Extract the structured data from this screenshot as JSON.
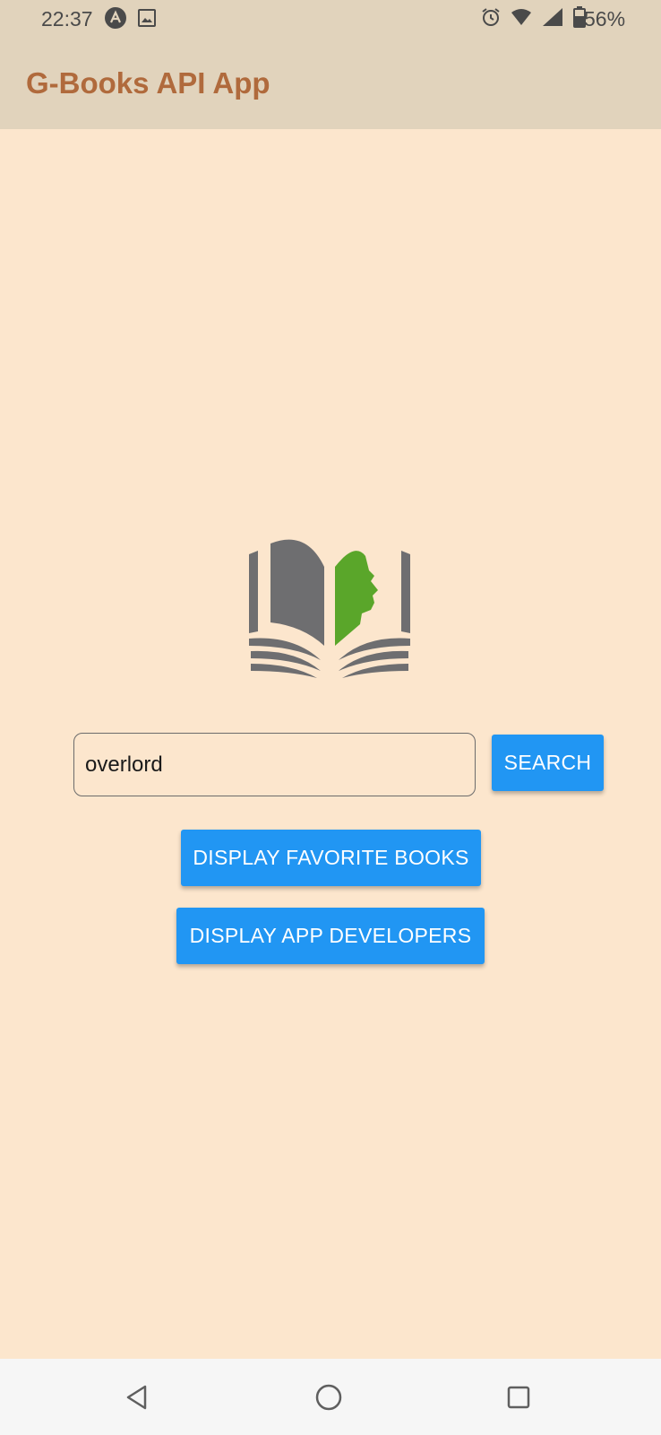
{
  "status_bar": {
    "time": "22:37",
    "battery_percent": "56%",
    "left_icons": [
      "android-notification-icon",
      "image-notification-icon"
    ],
    "right_icons": [
      "alarm-icon",
      "wifi-icon",
      "cell-signal-icon",
      "battery-icon"
    ]
  },
  "app_bar": {
    "title": "G-Books API App",
    "title_color": "#b06a3c",
    "background": "#e1d3bc"
  },
  "logo": {
    "icon": "open-book-with-face-icon",
    "colors": {
      "pages": "#6e6e70",
      "face": "#5aa62a"
    }
  },
  "search": {
    "value": "overlord",
    "button_label": "SEARCH"
  },
  "actions": {
    "favorites_label": "DISPLAY FAVORITE BOOKS",
    "developers_label": "DISPLAY APP DEVELOPERS"
  },
  "colors": {
    "background": "#fce6cd",
    "button": "#2196f3",
    "button_text": "#ffffff"
  },
  "nav_bar": {
    "icons": [
      "back-icon",
      "home-icon",
      "recents-icon"
    ]
  }
}
